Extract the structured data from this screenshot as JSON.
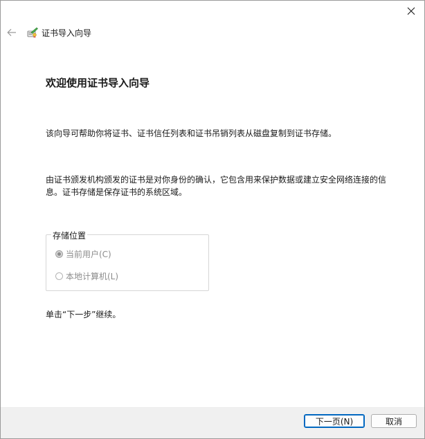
{
  "window": {
    "title": "证书导入向导"
  },
  "icons": {
    "close": "close-icon",
    "back": "back-arrow-icon",
    "wizard": "certificate-wizard-icon"
  },
  "main": {
    "heading": "欢迎使用证书导入向导",
    "paragraph1": "该向导可帮助你将证书、证书信任列表和证书吊销列表从磁盘复制到证书存储。",
    "paragraph2_line1": "由证书颁发机构颁发的证书是对你身份的确认，它包含用来保护数据或建立安全网络连接的信",
    "paragraph2_line2": "息。证书存储是保存证书的系统区域。",
    "store_location": {
      "label": "存储位置",
      "options": [
        {
          "label": "当前用户(C)",
          "checked": true,
          "disabled": true
        },
        {
          "label": "本地计算机(L)",
          "checked": false,
          "disabled": true
        }
      ]
    },
    "continue_text": "单击“下一步”继续。"
  },
  "footer": {
    "next_label": "下一页(N)",
    "cancel_label": "取消"
  },
  "colors": {
    "accent": "#0067c0",
    "disabled_text": "#8c8c8c",
    "footer_bg": "#f0f0f0"
  }
}
